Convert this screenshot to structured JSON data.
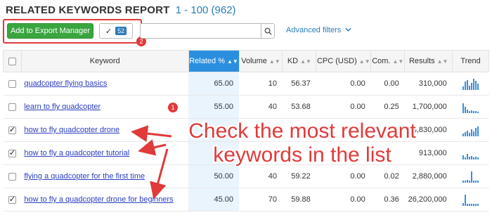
{
  "header": {
    "title": "RELATED KEYWORDS REPORT",
    "range": "1 - 100 (962)"
  },
  "toolbar": {
    "export_label": "Add to Export Manager",
    "selected_count": "52",
    "search_placeholder": "",
    "advanced_filters": "Advanced filters",
    "step_badge": "2"
  },
  "table": {
    "columns": [
      "Keyword",
      "Related %",
      "Volume",
      "KD",
      "CPC (USD)",
      "Com.",
      "Results",
      "Trend"
    ],
    "rows": [
      {
        "checked": false,
        "keyword": "quadcopter flying basics",
        "related": "65.00",
        "volume": "10",
        "kd": "56.37",
        "cpc": "0.00",
        "com": "0.00",
        "results": "310,000",
        "trend": [
          5,
          12,
          14,
          6,
          10,
          16,
          13,
          9
        ]
      },
      {
        "checked": false,
        "keyword": "learn to fly quadcopter",
        "related": "55.00",
        "volume": "40",
        "kd": "53.68",
        "cpc": "0.00",
        "com": "0.25",
        "results": "1,700,000",
        "trend": [
          14,
          9,
          5,
          3,
          4,
          3,
          3,
          2
        ]
      },
      {
        "checked": true,
        "keyword": "how to fly quadcopter drone",
        "related": "",
        "volume": "",
        "kd": "",
        "cpc": "",
        "com": "",
        "results": "8,830,000",
        "trend": [
          4,
          6,
          8,
          5,
          10,
          7,
          12,
          14
        ]
      },
      {
        "checked": true,
        "keyword": "how to fly a quadcopter tutorial",
        "related": "",
        "volume": "",
        "kd": "",
        "cpc": "",
        "com": "",
        "results": "913,000",
        "trend": [
          6,
          3,
          8,
          4,
          5,
          3,
          4,
          3
        ]
      },
      {
        "checked": false,
        "keyword": "flying a quadcopter for the first time",
        "related": "50.00",
        "volume": "40",
        "kd": "59.22",
        "cpc": "0.00",
        "com": "0.02",
        "results": "2,880,000",
        "trend": [
          3,
          3,
          4,
          3,
          16,
          3,
          3,
          3
        ]
      },
      {
        "checked": true,
        "keyword": "how to fly a quadcopter drone for beginners",
        "related": "45.00",
        "volume": "70",
        "kd": "59.88",
        "cpc": "0.00",
        "com": "0.36",
        "results": "26,200,000",
        "trend": [
          4,
          16,
          3,
          3,
          3,
          3,
          3,
          3
        ]
      }
    ]
  },
  "annotation": {
    "step_badge": "1",
    "text_line1": "Check the most relevant",
    "text_line2": "keywords in the list"
  },
  "colors": {
    "accent": "#2b8fe0",
    "annotation": "#e03a3a",
    "export_button": "#3aa53f",
    "link": "#2b3dc0"
  }
}
